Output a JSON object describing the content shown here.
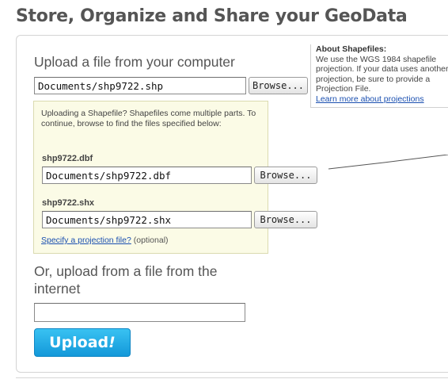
{
  "title": "Store, Organize and Share your GeoData",
  "local_upload": {
    "heading": "Upload a file from your computer",
    "file_value": "Documents/shp9722.shp",
    "browse_label": "Browse..."
  },
  "shapefile": {
    "note": "Uploading a Shapefile? Shapefiles come multiple parts. To continue, browse to find the files specified below:",
    "dbf": {
      "label": "shp9722.dbf",
      "value": "Documents/shp9722.dbf",
      "browse_label": "Browse..."
    },
    "shx": {
      "label": "shp9722.shx",
      "value": "Documents/shp9722.shx",
      "browse_label": "Browse..."
    },
    "projection_link": "Specify a projection file?",
    "projection_optional": "(optional)"
  },
  "about": {
    "title": "About Shapefiles:",
    "body": "We use the WGS 1984 shapefile projection. If your data uses another projection, be sure to provide a Projection File.",
    "link": "Learn more about projections"
  },
  "internet_upload": {
    "heading": "Or, upload from a file from the internet",
    "url_value": ""
  },
  "upload_button": {
    "label": "Upload",
    "suffix": "!",
    "color": "#1ea9e6"
  }
}
